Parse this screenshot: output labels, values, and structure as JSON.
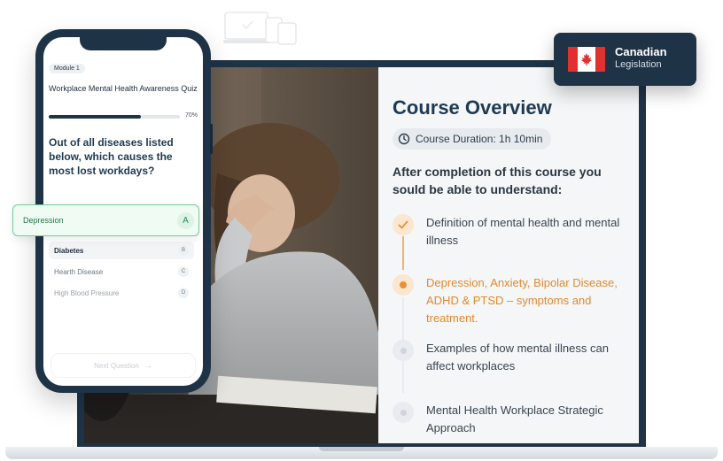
{
  "badge": {
    "line1": "Canadian",
    "line2": "Legislation",
    "colors": {
      "bg": "#1f3347",
      "flag_red": "#e03131"
    },
    "icon": "canada-flag-icon"
  },
  "course": {
    "title": "Course Overview",
    "duration": "Course Duration: 1h 10min",
    "intro": "After completion of this course you sould be able to understand:",
    "items": [
      {
        "text": "Definition of mental health and mental illness",
        "state": "done"
      },
      {
        "text": "Depression, Anxiety, Bipolar Disease, ADHD & PTSD – symptoms and treatment.",
        "state": "active"
      },
      {
        "text": "Examples of how mental illness can affect workplaces",
        "state": "pending"
      },
      {
        "text": "Mental Health Workplace Strategic Approach",
        "state": "pending"
      }
    ],
    "colors": {
      "title": "#1e3a52",
      "active": "#e38a2c",
      "panel": "#f4f6f8"
    }
  },
  "quiz": {
    "module": "Module 1",
    "title": "Workplace Mental Health Awareness Quiz",
    "progress": 70,
    "progress_label": "70%",
    "question": "Out of all diseases listed below, which causes the most lost workdays?",
    "selected": {
      "text": "Depression",
      "letter": "A"
    },
    "answers": [
      {
        "text": "Diabetes",
        "letter": "B"
      },
      {
        "text": "Hearth Disease",
        "letter": "C"
      },
      {
        "text": "High Blood Pressure",
        "letter": "D"
      }
    ],
    "next_label": "Next Question",
    "colors": {
      "selected_border": "#6fcf97",
      "selected_text": "#1f7a44"
    }
  }
}
